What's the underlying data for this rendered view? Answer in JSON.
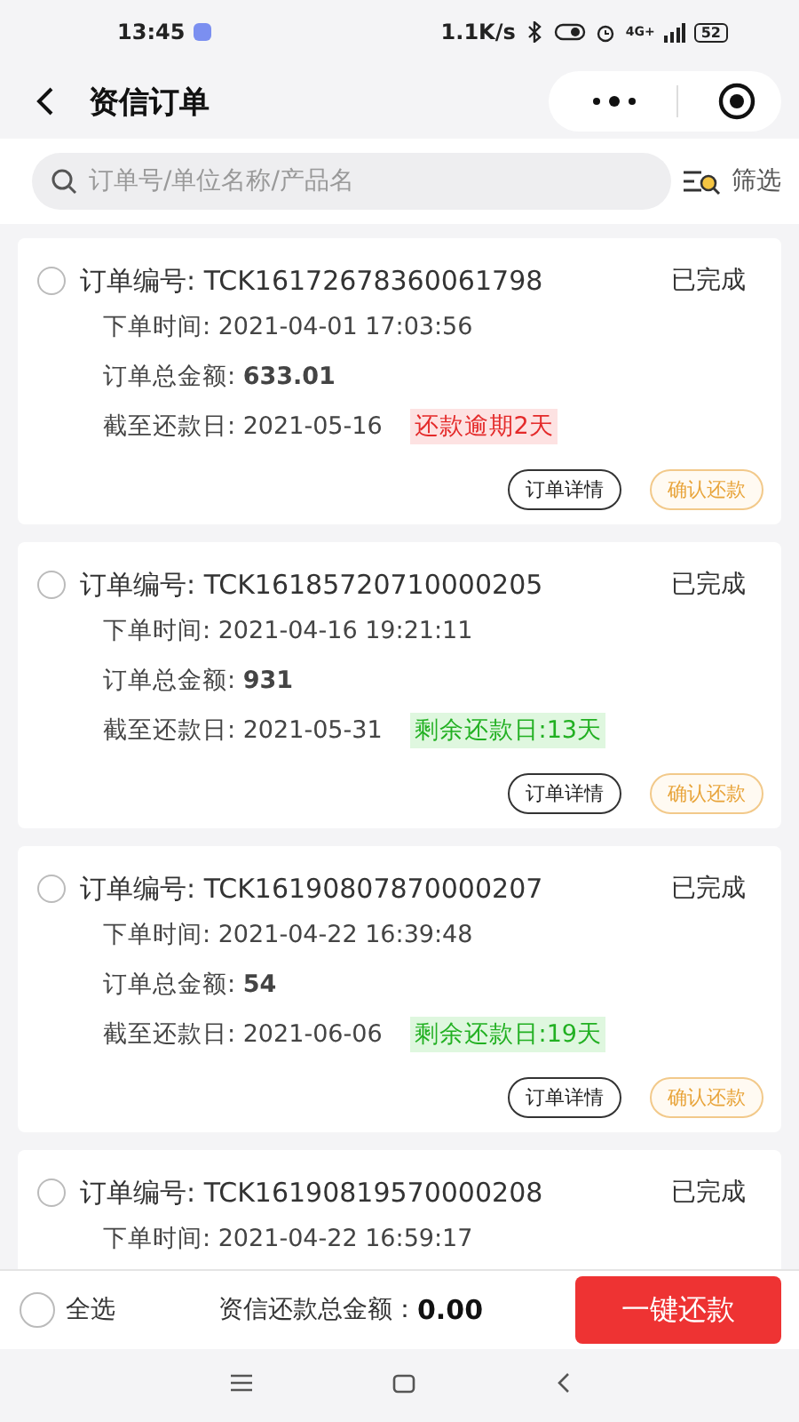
{
  "status_bar": {
    "time": "13:45",
    "net_speed": "1.1K/s",
    "network": "4G+",
    "battery": "52"
  },
  "header": {
    "title": "资信订单"
  },
  "search": {
    "placeholder": "订单号/单位名称/产品名",
    "filter_label": "筛选"
  },
  "orders": [
    {
      "selected": false,
      "order_no": "订单编号: TCK16172678360061798",
      "status": "已完成",
      "order_time": "下单时间: 2021-04-01 17:03:56",
      "total": "订单总金额: **633.01**",
      "due_date": "截至还款日: 2021-05-16",
      "due_tag": {
        "kind": "overdue",
        "text": "还款逾期2天"
      },
      "buttons": [
        "订单详情",
        "确认还款"
      ]
    },
    {
      "selected": false,
      "order_no": "订单编号: TCK16185720710000205",
      "status": "已完成",
      "order_time": "下单时间: 2021-04-16 19:21:11",
      "total": "订单总金额: **931**",
      "due_date": "截至还款日: 2021-05-31",
      "due_tag": {
        "kind": "remaining",
        "text": "剩余还款日:13天"
      },
      "buttons": [
        "订单详情",
        "确认还款"
      ]
    },
    {
      "selected": false,
      "order_no": "订单编号: TCK16190807870000207",
      "status": "已完成",
      "order_time": "下单时间: 2021-04-22 16:39:48",
      "total": "订单总金额: **54**",
      "due_date": "截至还款日: 2021-06-06",
      "due_tag": {
        "kind": "remaining",
        "text": "剩余还款日:19天"
      },
      "buttons": [
        "订单详情",
        "确认还款"
      ]
    },
    {
      "selected": false,
      "order_no": "订单编号: TCK16190819570000208",
      "status": "已完成",
      "order_time": "下单时间: 2021-04-22 16:59:17"
    }
  ],
  "footer": {
    "select_all": {
      "label": "全选",
      "selected": false
    },
    "total_label": "资信还款总金额：",
    "total_value": "0.00",
    "pay_button": "一键还款"
  }
}
